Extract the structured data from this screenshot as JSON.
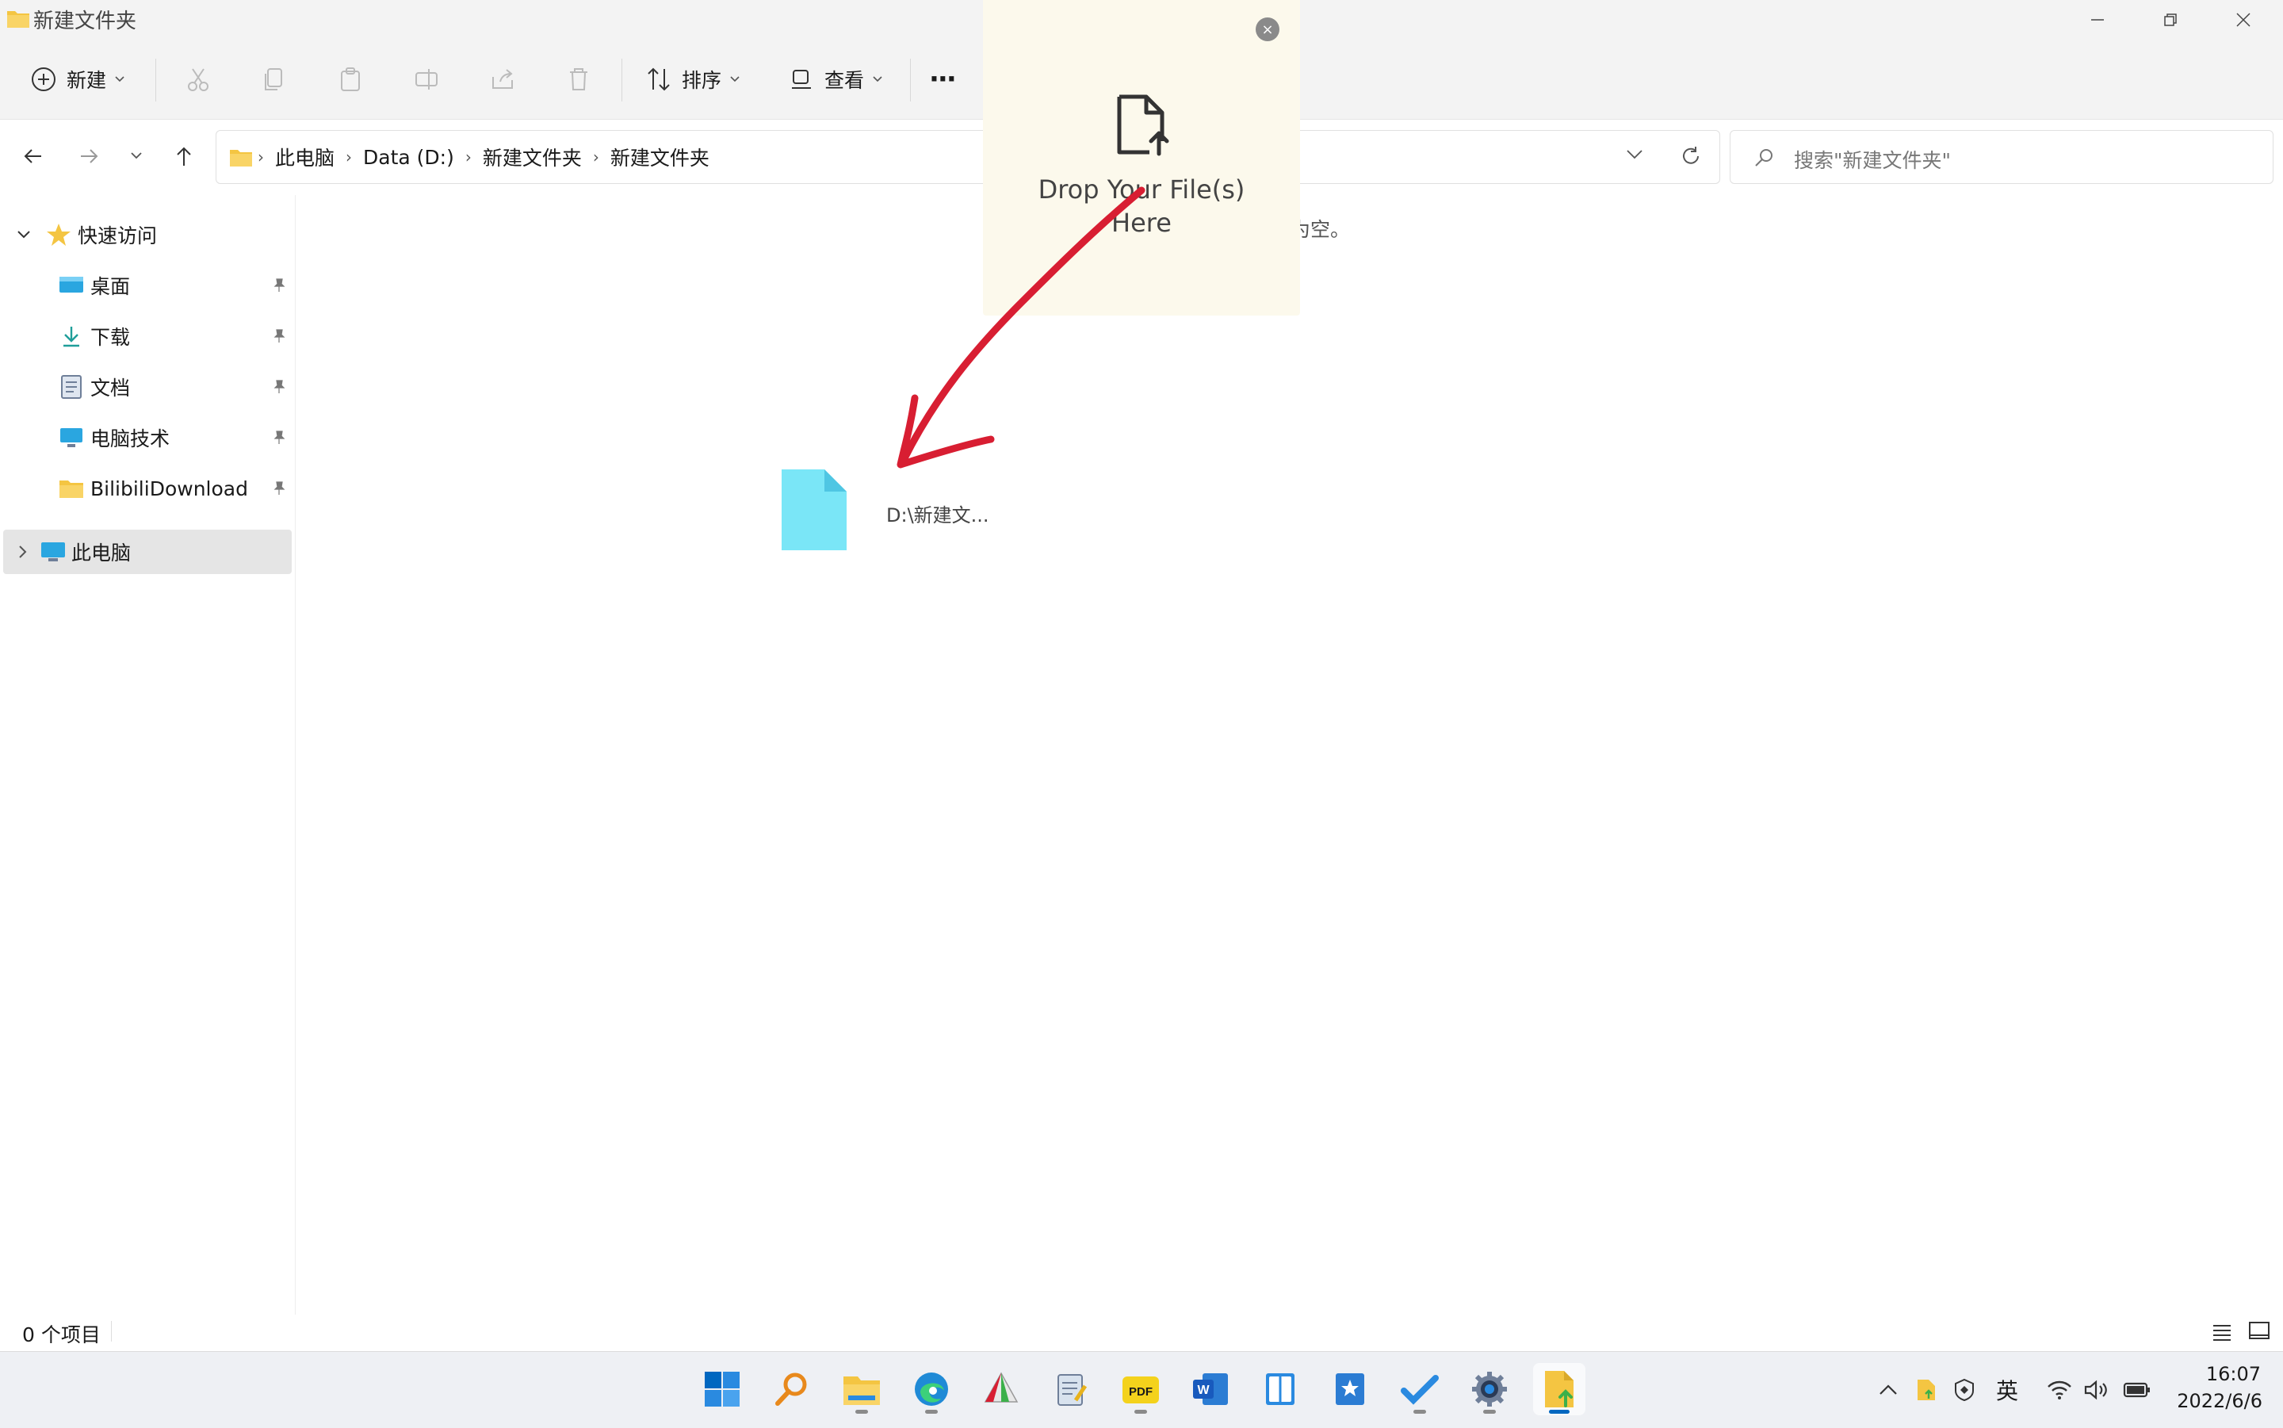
{
  "window": {
    "title": "新建文件夹"
  },
  "toolbar": {
    "new_label": "新建",
    "sort_label": "排序",
    "view_label": "查看",
    "more_label": "···"
  },
  "address": {
    "crumbs": [
      "此电脑",
      "Data (D:)",
      "新建文件夹",
      "新建文件夹"
    ]
  },
  "search": {
    "placeholder": "搜索\"新建文件夹\""
  },
  "sidebar": {
    "quick_access": "快速访问",
    "items": [
      {
        "label": "桌面",
        "icon": "desktop-icon"
      },
      {
        "label": "下载",
        "icon": "download-icon"
      },
      {
        "label": "文档",
        "icon": "document-icon"
      },
      {
        "label": "电脑技术",
        "icon": "monitor-icon"
      },
      {
        "label": "BilibiliDownload",
        "icon": "folder-icon"
      }
    ],
    "this_pc": "此电脑"
  },
  "main": {
    "empty_fragment": "为空。",
    "dragged_file_label": "D:\\新建文..."
  },
  "dropzone": {
    "text_line1": "Drop Your File(s)",
    "text_line2": "Here",
    "close_label": "×"
  },
  "statusbar": {
    "item_count": "0 个项目"
  },
  "taskbar": {
    "ime_label": "英",
    "time": "16:07",
    "date": "2022/6/6"
  },
  "colors": {
    "accent_blue": "#0067c0",
    "folder_yellow": "#f4c542",
    "file_cyan": "#7ae6f7",
    "arrow_red": "#d81e32",
    "drop_bg": "#fcf9ec"
  }
}
